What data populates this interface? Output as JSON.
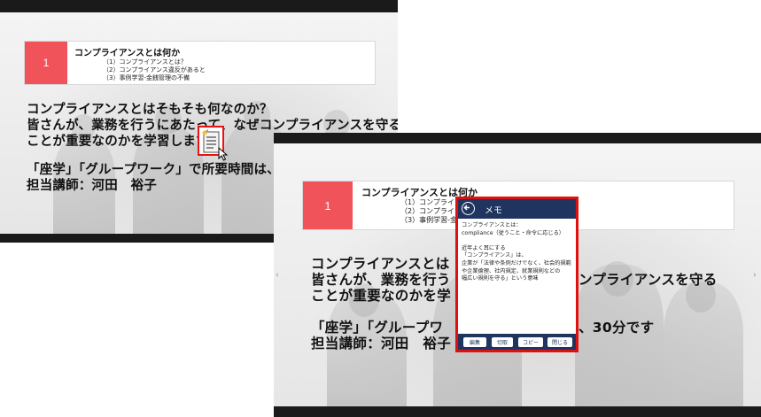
{
  "slide": {
    "toc": {
      "number": "1",
      "title": "コンプライアンスとは何か",
      "items": [
        "（1）コンプライアンスとは？",
        "（2）コンプライアンス違反があると",
        "（3）事例学習-金銭管理の不備"
      ]
    },
    "intro_lines": [
      "コンプライアンスとはそもそも何なのか？",
      "皆さんが、業務を行うにあたって、なぜコンプライアンスを守る",
      "ことが重要なのかを学習します。"
    ],
    "info_lines": [
      "「座学」「グループワーク」で所要時間は、30分です",
      "担当講師：河田　裕子"
    ],
    "slide2_fragments": {
      "intro_1": "コンプライアンスとは",
      "intro_2a": "皆さんが、業務を行う",
      "intro_2b": "ンプライアンスを守る",
      "intro_3": "ことが重要なのかを学",
      "info_1a": "「座学」「グループワ",
      "info_1b": "、30分です",
      "info_2": "担当講師：河田　裕子",
      "toc_item_2": "（2）コンプライ",
      "toc_item_3": "（3）事例学習-金"
    }
  },
  "memo": {
    "title": "メモ",
    "lines": [
      "コンプライアンスとは：",
      "compliance（従うこと・命令に応じる）",
      "",
      "近年よく耳にする",
      "「コンプライアンス」は、",
      "企業が「法律や条例だけでなく、社会的規範",
      "や企業倫理、社内規定、就業規則などの",
      "幅広い規則を守る」という意味"
    ],
    "buttons": [
      "編集",
      "切取",
      "コピー",
      "閉じる"
    ]
  },
  "colors": {
    "accent_red": "#f0545a",
    "memo_header": "#1f3560",
    "highlight_border": "#e01010"
  }
}
